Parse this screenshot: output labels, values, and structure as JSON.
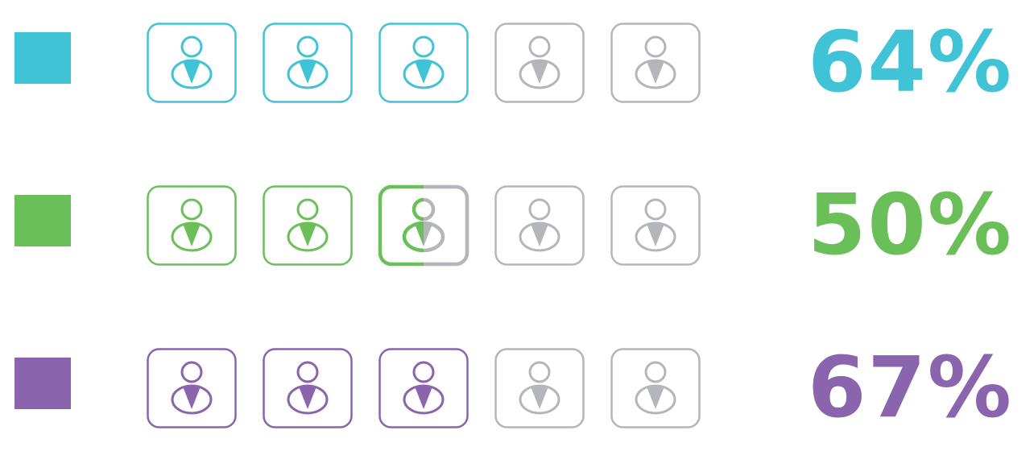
{
  "chart_data": {
    "type": "pictograph",
    "icon": "person-icon",
    "icons_per_row": 5,
    "empty_color": "#b4b6bb",
    "rows": [
      {
        "value": 64,
        "label": "64%",
        "filled_icons": 3,
        "color": "#40c2d7"
      },
      {
        "value": 50,
        "label": "50%",
        "filled_icons": 2.5,
        "color": "#6abf59"
      },
      {
        "value": 67,
        "label": "67%",
        "filled_icons": 3,
        "color": "#8a64ad"
      }
    ]
  }
}
